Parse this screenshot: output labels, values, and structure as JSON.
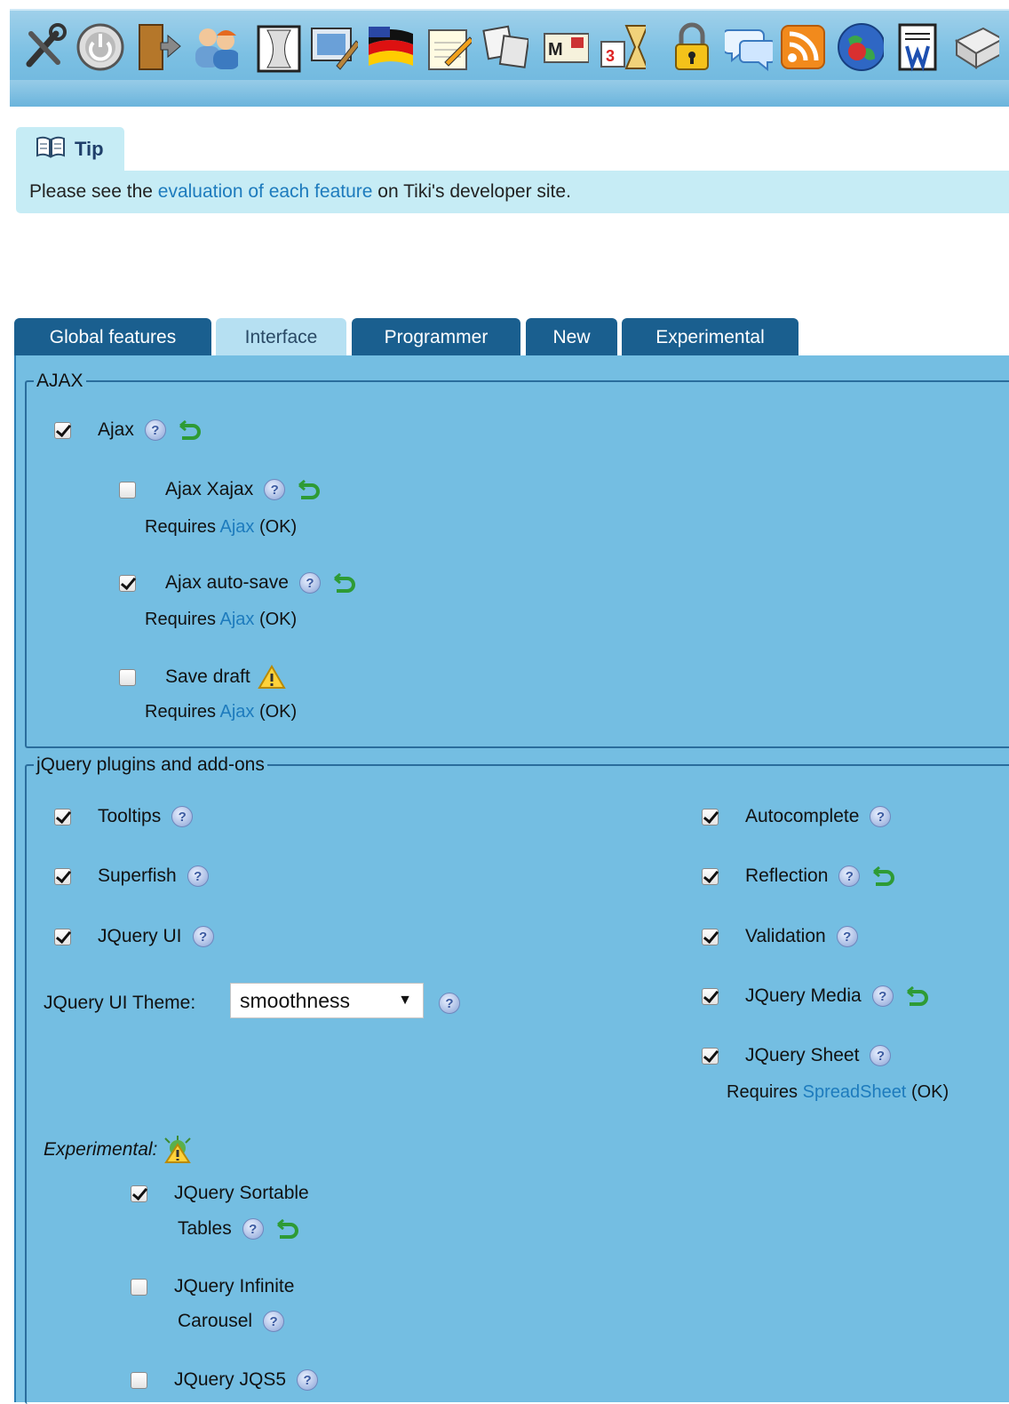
{
  "toolbar": {
    "icons": [
      "tools-icon",
      "power-icon",
      "login-door-icon",
      "users-icon",
      "page-icon",
      "image-edit-icon",
      "language-flag-icon",
      "notepad-edit-icon",
      "files-icon",
      "mail-icon",
      "calendar-hourglass-icon",
      "lock-icon",
      "comments-icon",
      "rss-icon",
      "globe-icon",
      "wiki-document-icon",
      "drive-icon"
    ]
  },
  "tip": {
    "title": "Tip",
    "text_before": "Please see the ",
    "link": "evaluation of each feature",
    "text_after": " on Tiki's developer site."
  },
  "tabs": [
    {
      "label": "Global features",
      "active": false
    },
    {
      "label": "Interface",
      "active": true
    },
    {
      "label": "Programmer",
      "active": false
    },
    {
      "label": "New",
      "active": false
    },
    {
      "label": "Experimental",
      "active": false
    }
  ],
  "ajax": {
    "legend": "AJAX",
    "ajax_label": "Ajax",
    "xajax_label": "Ajax Xajax",
    "autosave_label": "Ajax auto-save",
    "savedraft_label": "Save draft",
    "requires_word": "Requires",
    "requires_link": "Ajax",
    "requires_status": "(OK)"
  },
  "jquery": {
    "legend": "jQuery plugins and add-ons",
    "tooltips": "Tooltips",
    "superfish": "Superfish",
    "jqueryui": "JQuery UI",
    "theme_label": "JQuery UI Theme:",
    "theme_value": "smoothness",
    "autocomplete": "Autocomplete",
    "reflection": "Reflection",
    "validation": "Validation",
    "media": "JQuery Media",
    "sheet": "JQuery Sheet",
    "sheet_requires_word": "Requires",
    "sheet_requires_link": "SpreadSheet",
    "sheet_requires_status": "(OK)",
    "experimental_label": "Experimental:",
    "sortable_line1": "JQuery Sortable",
    "sortable_line2": "Tables",
    "carousel_line1": "JQuery Infinite",
    "carousel_line2": "Carousel",
    "jqs5": "JQuery JQS5"
  }
}
